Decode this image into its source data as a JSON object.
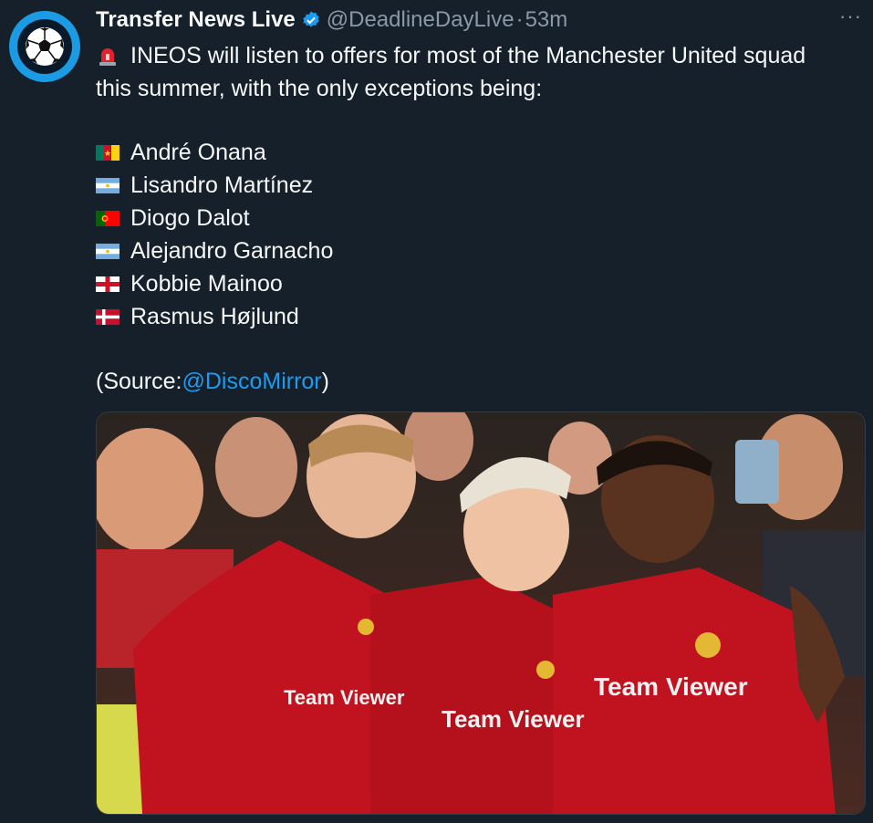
{
  "tweet": {
    "display_name": "Transfer News Live",
    "handle": "@DeadlineDayLive",
    "separator": "·",
    "time": "53m",
    "more": "···",
    "intro_line1": "INEOS will listen to offers for most of the Manchester United squad",
    "intro_line2": "this summer, with the only exceptions being:",
    "players": [
      {
        "name": "André Onana",
        "flag": "cameroon-flag-icon"
      },
      {
        "name": "Lisandro Martínez",
        "flag": "argentina-flag-icon"
      },
      {
        "name": "Diogo Dalot",
        "flag": "portugal-flag-icon"
      },
      {
        "name": "Alejandro Garnacho",
        "flag": "argentina-flag-icon"
      },
      {
        "name": "Kobbie Mainoo",
        "flag": "england-flag-icon"
      },
      {
        "name": "Rasmus Højlund",
        "flag": "denmark-flag-icon"
      }
    ],
    "source_prefix": "(Source: ",
    "source_mention": "@DiscoMirror",
    "source_suffix": ")"
  },
  "photo": {
    "shirt_sponsor_1": "Team Viewer",
    "shirt_sponsor_2": "Team Viewer",
    "shirt_sponsor_3": "Team Viewer"
  },
  "colors": {
    "background": "#15202b",
    "text": "#f7f9f9",
    "muted": "#8b98a5",
    "link": "#1d9bf0",
    "avatar": "#1b9be3",
    "shirt_red": "#c1121f"
  }
}
